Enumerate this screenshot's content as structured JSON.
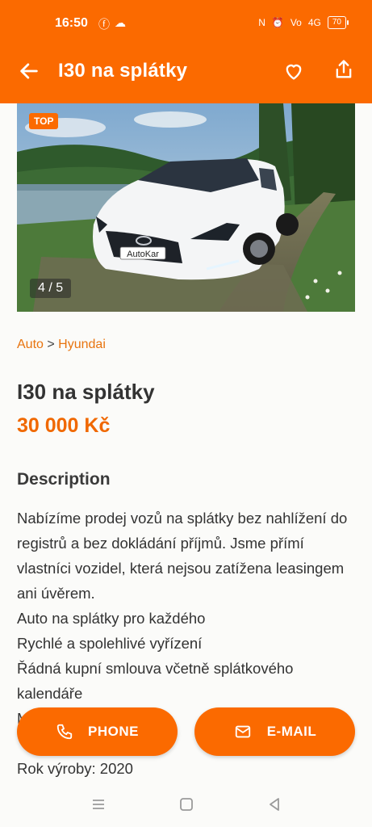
{
  "status": {
    "time": "16:50",
    "battery": "70",
    "network": "4G"
  },
  "appbar": {
    "title": "I30 na splátky"
  },
  "gallery": {
    "badge": "TOP",
    "counter": "4 / 5",
    "plate_text": "AutoKar"
  },
  "breadcrumb": {
    "category": "Auto",
    "separator": ">",
    "brand": "Hyundai"
  },
  "listing": {
    "title": "I30 na splátky",
    "price": "30 000 Kč",
    "description_heading": "Description",
    "description": "Nabízíme prodej vozů na splátky bez nahlížení do registrů a bez dokládání příjmů. Jsme přímí vlastníci vozidel, která nejsou zatížena leasingem ani úvěrem.\nAuto na splátky pro každého\n Rychlé a spolehlivé vyřízení\n Řádná kupní smlouva včetně splátkového kalendáře\n M                         PH\n \nRok výroby: 2020"
  },
  "actions": {
    "phone_label": "PHONE",
    "email_label": "E-MAIL"
  },
  "colors": {
    "accent": "#fb6a00",
    "price": "#f06800",
    "link": "#e8740f"
  }
}
